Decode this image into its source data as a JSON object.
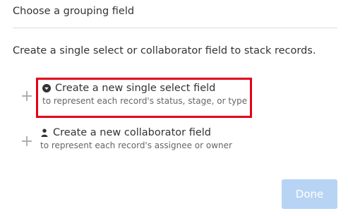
{
  "header": {
    "title": "Choose a grouping field"
  },
  "description": "Create a single select or collaborator field to stack records.",
  "options": [
    {
      "title": "Create a new single select field",
      "subtitle": "to represent each record's status, stage, or type",
      "icon": "single-select-icon"
    },
    {
      "title": "Create a new collaborator field",
      "subtitle": "to represent each record's assignee or owner",
      "icon": "person-icon"
    }
  ],
  "footer": {
    "done_label": "Done"
  },
  "colors": {
    "highlight_border": "#e3001b",
    "done_button_bg": "#b8d4f5",
    "plus_icon": "#b0b0b0"
  }
}
